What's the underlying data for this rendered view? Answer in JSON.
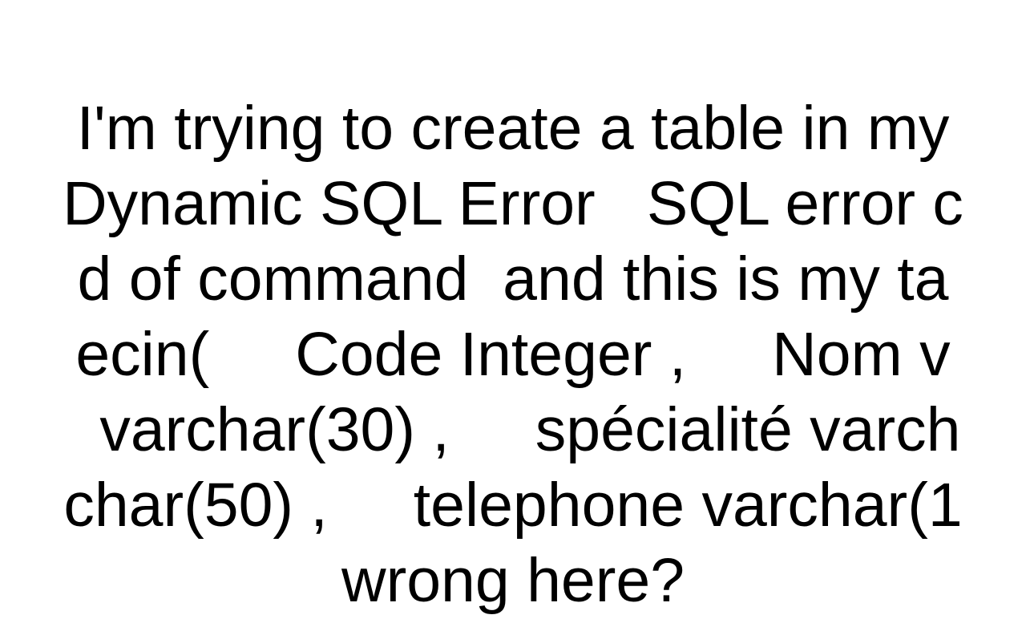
{
  "lines": [
    "I'm trying to create a table in my",
    "Dynamic SQL Error   SQL error c",
    "d of command  and this is my ta",
    "ecin(     Code Integer ,     Nom v",
    "  varchar(30) ,     spécialité varch",
    "char(50) ,     telephone varchar(1",
    "wrong here?"
  ]
}
